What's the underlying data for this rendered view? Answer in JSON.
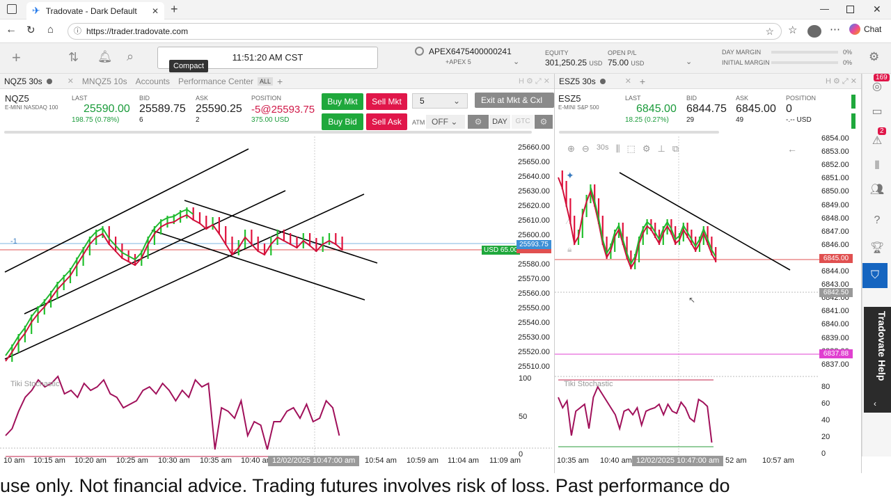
{
  "browser": {
    "tab_title": "Tradovate - Dark Default",
    "url": "https://trader.tradovate.com",
    "chat_label": "Chat"
  },
  "app": {
    "time": "11:51:20 AM CST",
    "compact_tooltip": "Compact",
    "account": "APEX6475400000241",
    "account_sub": "+APEX 5",
    "equity_label": "EQUITY",
    "equity_value": "301,250.25",
    "equity_unit": "USD",
    "openpl_label": "OPEN P/L",
    "openpl_value": "75.00",
    "openpl_unit": "USD",
    "day_margin_label": "DAY MARGIN",
    "day_margin_pct": "0%",
    "initial_margin_label": "INITIAL MARGIN",
    "initial_margin_pct": "0%"
  },
  "left": {
    "tabs": [
      "NQZ5 30s",
      "MNQZ5 10s",
      "Accounts",
      "Performance Center",
      "ALL"
    ],
    "symbol": "NQZ5",
    "symbol_sub": "E-MINI NASDAQ 100",
    "last_label": "LAST",
    "last": "25590.00",
    "last_change": "198.75 (0.78%)",
    "bid_label": "BID",
    "bid": "25589.75",
    "bid_size": "6",
    "ask_label": "ASK",
    "ask": "25590.25",
    "ask_size": "2",
    "pos_label": "POSITION",
    "pos": "-5@25593.75",
    "pos_pl": "375.00 USD",
    "buy_mkt": "Buy Mkt",
    "sell_mkt": "Sell Mkt",
    "buy_bid": "Buy Bid",
    "sell_ask": "Sell Ask",
    "qty": "5",
    "exit_btn": "Exit at Mkt & Cxl",
    "atm_label": "ATM",
    "atm_value": "OFF",
    "day": "DAY",
    "gtc": "GTC",
    "y_ticks": [
      "25660.00",
      "25650.00",
      "25640.00",
      "25630.00",
      "25620.00",
      "25610.00",
      "25600.00",
      "25590.00",
      "25580.00",
      "25570.00",
      "25560.00",
      "25550.00",
      "25540.00",
      "25530.00",
      "25520.00",
      "25510.00"
    ],
    "pos_marker": "-1",
    "price_tag": "25593.75",
    "pl_tag": "USD 65.00",
    "osc_label": "Tiki Stochastic",
    "osc_ticks": [
      "100",
      "50",
      "0"
    ],
    "x_ticks": [
      "10 am",
      "10:15 am",
      "10:20 am",
      "10:25 am",
      "10:30 am",
      "10:35 am",
      "10:40 am",
      "10:54 am",
      "10:59 am",
      "11:04 am",
      "11:09 am"
    ],
    "crosshair_time": "12/02/2025 10:47:00 am"
  },
  "right": {
    "tab": "ESZ5 30s",
    "symbol": "ESZ5",
    "symbol_sub": "E-MINI S&P 500",
    "last_label": "LAST",
    "last": "6845.00",
    "last_change": "18.25 (0.27%)",
    "bid_label": "BID",
    "bid": "6844.75",
    "bid_size": "29",
    "ask_label": "ASK",
    "ask": "6845.00",
    "ask_size": "49",
    "pos_label": "POSITION",
    "pos": "0",
    "pos_pl": "-.-- USD",
    "interval": "30s",
    "y_ticks": [
      "6854.00",
      "6853.00",
      "6852.00",
      "6851.00",
      "6850.00",
      "6849.00",
      "6848.00",
      "6847.00",
      "6846.00",
      "6845.00",
      "6844.00",
      "6843.00",
      "6842.00",
      "6841.00",
      "6840.00",
      "6839.00",
      "6838.00",
      "6837.00"
    ],
    "price_tag": "6845.00",
    "cross_tag": "6842.50",
    "line_tag": "6837.88",
    "osc_label": "Tiki Stochastic",
    "osc_ticks": [
      "80",
      "60",
      "40",
      "20",
      "0"
    ],
    "x_ticks": [
      "10:35 am",
      "10:40 am",
      "52 am",
      "10:57 am"
    ],
    "crosshair_time": "12/02/2025 10:47:00 am"
  },
  "sidebar": {
    "badge1": "169",
    "badge2": "2",
    "help": "Tradovate Help"
  },
  "ticker": "use only. Not financial advice. Trading futures involves risk of loss. Past performance do"
}
